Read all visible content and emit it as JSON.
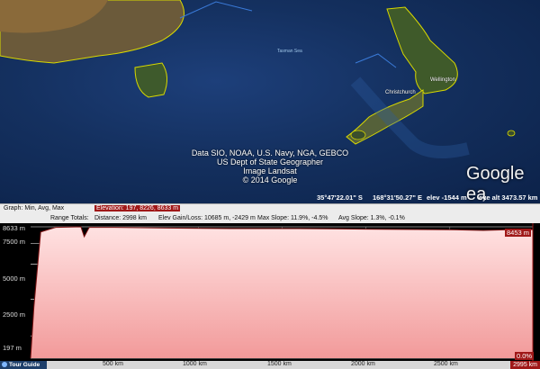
{
  "map": {
    "sea_label": "Tasman Sea",
    "city_wellington": "Wellington",
    "city_christchurch": "Christchurch",
    "attribution": [
      "Data SIO, NOAA, U.S. Navy, NGA, GEBCO",
      "US Dept of State Geographer",
      "Image Landsat",
      "© 2014 Google"
    ],
    "logo": "Google ea",
    "status": {
      "lat": "35°47'22.01\" S",
      "lon": "168°31'50.27\" E",
      "elev": "elev -1544 m",
      "eye_alt": "eye alt 3473.57 km"
    }
  },
  "profile_info": {
    "graph_label": "Graph: Min, Avg, Max",
    "elevation": "Elevation: 197, 8226, 8633 m",
    "range_totals": "Range Totals:",
    "distance": "Distance: 2998 km",
    "elev_gain_loss": "Elev Gain/Loss: 10685 m, -2429 m",
    "max_slope": "Max Slope: 11.9%, -4.5%",
    "avg_slope": "Avg Slope: 1.3%, -0.1%"
  },
  "y_axis": [
    "8633 m",
    "7500 m",
    "5000 m",
    "2500 m",
    "197 m"
  ],
  "x_axis": [
    "500 km",
    "1000 km",
    "1500 km",
    "2000 km",
    "2500 km",
    "2995 km"
  ],
  "current_value": "8453 m",
  "slope_value": "0.0%",
  "tour_guide": "Tour Guide",
  "colors": {
    "profile_fill": "#f6b0b0",
    "badge": "#a01818"
  },
  "chart_data": {
    "type": "area",
    "x": [
      0,
      20,
      60,
      150,
      300,
      320,
      350,
      500,
      800,
      1200,
      1600,
      2000,
      2300,
      2500,
      2700,
      2900,
      2995
    ],
    "y": [
      197,
      3500,
      8300,
      8600,
      8633,
      8000,
      8600,
      8600,
      8550,
      8520,
      8520,
      8480,
      8460,
      8450,
      8400,
      8460,
      8453
    ],
    "ylim": [
      197,
      8633
    ],
    "xlim": [
      0,
      2995
    ]
  }
}
